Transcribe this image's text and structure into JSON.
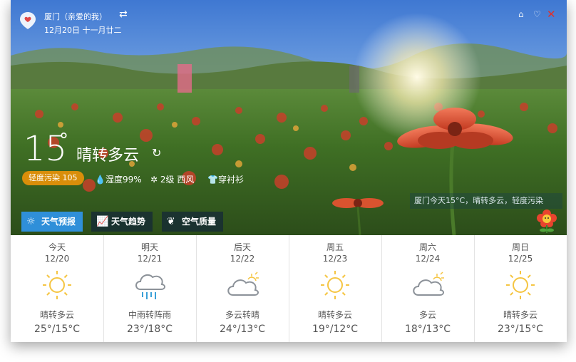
{
  "app": {
    "city": "厦门（亲爱的我）",
    "date": "12月20日 十一月廿二"
  },
  "current": {
    "temp": "15",
    "degree_symbol": "°",
    "condition": "晴转多云",
    "aqi_badge": "轻度污染 105",
    "humidity": "湿度99%",
    "wind": "2级 西风",
    "clothing": "穿衬衫",
    "notice": "厦门今天15°C，晴转多云，轻度污染"
  },
  "tabs": [
    {
      "label": "天气预报",
      "icon": "sun-icon",
      "active": true
    },
    {
      "label": "天气趋势",
      "icon": "trend-chart-icon",
      "active": false
    },
    {
      "label": "空气质量",
      "icon": "leaf-icon",
      "active": false
    }
  ],
  "forecast": [
    {
      "name": "今天",
      "date": "12/20",
      "desc": "晴转多云",
      "temps": "25°/15°C",
      "icon": "sun-icon"
    },
    {
      "name": "明天",
      "date": "12/21",
      "desc": "中雨转阵雨",
      "temps": "23°/18°C",
      "icon": "rain-cloud-icon"
    },
    {
      "name": "后天",
      "date": "12/22",
      "desc": "多云转晴",
      "temps": "24°/13°C",
      "icon": "cloud-sun-icon"
    },
    {
      "name": "周五",
      "date": "12/23",
      "desc": "晴转多云",
      "temps": "19°/12°C",
      "icon": "sun-icon"
    },
    {
      "name": "周六",
      "date": "12/24",
      "desc": "多云",
      "temps": "18°/13°C",
      "icon": "cloud-sun-icon"
    },
    {
      "name": "周日",
      "date": "12/25",
      "desc": "晴转多云",
      "temps": "23°/15°C",
      "icon": "sun-icon"
    }
  ],
  "colors": {
    "sky_top": "#4f86d6",
    "accent_blue": "#2f8fd9",
    "aqi_orange": "#d98e0a",
    "close_red": "#e0302a",
    "sun_yellow": "#f5c542"
  }
}
